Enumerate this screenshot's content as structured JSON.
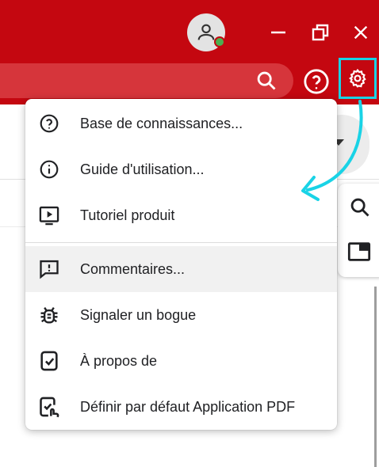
{
  "menu": {
    "items": [
      {
        "label": "Base de connaissances...",
        "icon": "help-circle-icon"
      },
      {
        "label": "Guide d'utilisation...",
        "icon": "info-circle-icon"
      },
      {
        "label": "Tutoriel produit",
        "icon": "video-tutorial-icon"
      },
      {
        "label": "Commentaires...",
        "icon": "feedback-icon"
      },
      {
        "label": "Signaler un bogue",
        "icon": "bug-icon"
      },
      {
        "label": "À propos de",
        "icon": "about-icon"
      },
      {
        "label": "Définir par défaut Application PDF",
        "icon": "set-default-icon"
      }
    ],
    "highlighted_item": "Commentaires..."
  },
  "colors": {
    "titlebar": "#c40710",
    "annotation": "#19d3e6",
    "status_online": "#4caf50"
  }
}
